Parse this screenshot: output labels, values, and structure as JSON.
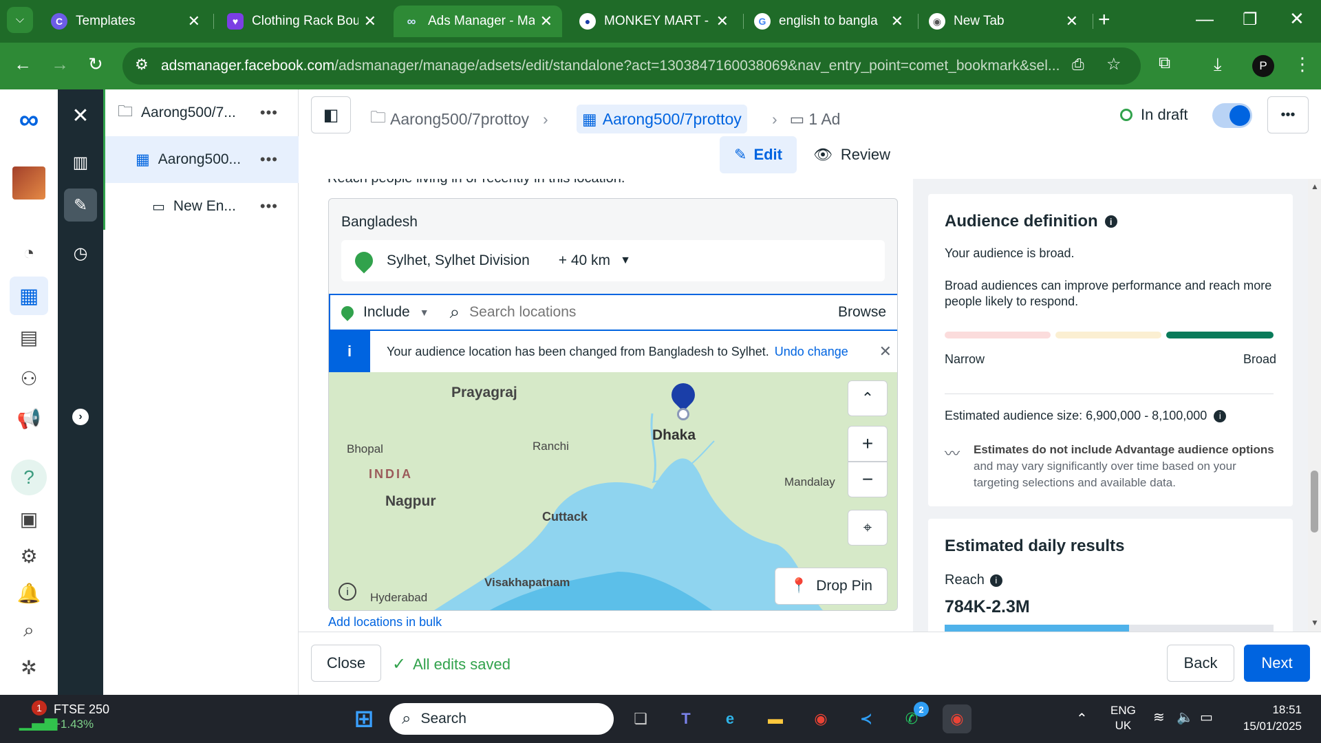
{
  "browser": {
    "tabs": [
      {
        "title": "Templates",
        "icon": "canva-icon"
      },
      {
        "title": "Clothing Rack Bou",
        "icon": "heart-icon"
      },
      {
        "title": "Ads Manager - Ma",
        "icon": "meta-icon"
      },
      {
        "title": "MONKEY MART - I",
        "icon": "monkey-icon"
      },
      {
        "title": "english to bangla",
        "icon": "google-icon"
      },
      {
        "title": "New Tab",
        "icon": "chrome-icon"
      }
    ],
    "url_host": "adsmanager.facebook.com",
    "url_path": "/adsmanager/manage/adsets/edit/standalone?act=1303847160038069&nav_entry_point=comet_bookmark&sel...",
    "profile_initial": "P"
  },
  "tree": {
    "campaign": "Aarong500/7...",
    "adset": "Aarong500...",
    "ad": "New En..."
  },
  "header": {
    "crumb_campaign": "Aarong500/7prottoy",
    "crumb_adset": "Aarong500/7prottoy",
    "crumb_ad": "1 Ad",
    "status": "In draft",
    "edit_label": "Edit",
    "review_label": "Review"
  },
  "location": {
    "cut_text": "Reach people living in or recently in this location.",
    "country": "Bangladesh",
    "place": "Sylhet, Sylhet Division",
    "radius": "+ 40 km",
    "include_label": "Include",
    "search_placeholder": "Search locations",
    "browse_label": "Browse",
    "notice": "Your audience location has been changed from Bangladesh to Sylhet.",
    "undo_label": "Undo change",
    "drop_pin_label": "Drop Pin",
    "bulk_label": "Add locations in bulk",
    "map_labels": {
      "prayagraj": "Prayagraj",
      "dhaka": "Dhaka",
      "bhopal": "Bhopal",
      "ranchi": "Ranchi",
      "india": "INDIA",
      "nagpur": "Nagpur",
      "mandalay": "Mandalay",
      "cuttack": "Cuttack",
      "hyderabad": "Hyderabad",
      "visakhapatnam": "Visakhapatnam"
    }
  },
  "audience": {
    "title": "Audience definition",
    "summary": "Your audience is broad.",
    "description": "Broad audiences can improve performance and reach more people likely to respond.",
    "narrow_label": "Narrow",
    "broad_label": "Broad",
    "size_text": "Estimated audience size: 6,900,000 - 8,100,000",
    "note_bold": "Estimates do not include Advantage audience options",
    "note_rest": " and may vary significantly over time based on your targeting selections and available data.",
    "gauge_segments": 3,
    "gauge_active_segment": 3
  },
  "daily": {
    "title": "Estimated daily results",
    "reach_label": "Reach",
    "reach_value": "784K-2.3M",
    "reach_bar_fraction": 0.56
  },
  "footer": {
    "close_label": "Close",
    "saved_label": "All edits saved",
    "back_label": "Back",
    "next_label": "Next"
  },
  "taskbar": {
    "stock_name": "FTSE 250",
    "stock_change": "+1.43%",
    "stock_badge": "1",
    "search_label": "Search",
    "whatsapp_badge": "2",
    "lang": "ENG",
    "region": "UK",
    "time": "18:51",
    "date": "15/01/2025"
  },
  "colors": {
    "chrome_green": "#2e8a36",
    "meta_blue": "#0064e0",
    "include_green": "#31a24c",
    "broad_green": "#0a7b5a"
  }
}
